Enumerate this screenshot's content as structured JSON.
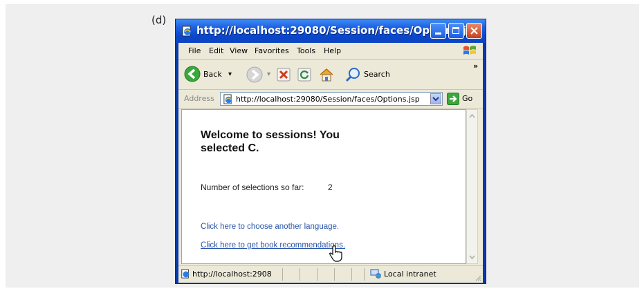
{
  "figure": {
    "label": "(d)"
  },
  "window": {
    "title": "http://localhost:29080/Session/faces/Options.j...",
    "menu": [
      "File",
      "Edit",
      "View",
      "Favorites",
      "Tools",
      "Help"
    ],
    "toolbar": {
      "back_label": "Back",
      "search_label": "Search",
      "overflow": "»"
    },
    "address": {
      "label": "Address",
      "url": "http://localhost:29080/Session/faces/Options.jsp",
      "go_label": "Go"
    }
  },
  "page": {
    "heading": "Welcome to sessions! You selected C.",
    "count_label": "Number of selections so far:",
    "count_value": "2",
    "link_language": "Click here to choose another language.",
    "link_books": "Click here to get book recommendations."
  },
  "statusbar": {
    "url": "http://localhost:2908",
    "zone": "Local intranet"
  },
  "colors": {
    "titlebar": "#0a47cc",
    "link": "#2a55a8",
    "chrome": "#ece9d8",
    "panel": "#efefef"
  }
}
